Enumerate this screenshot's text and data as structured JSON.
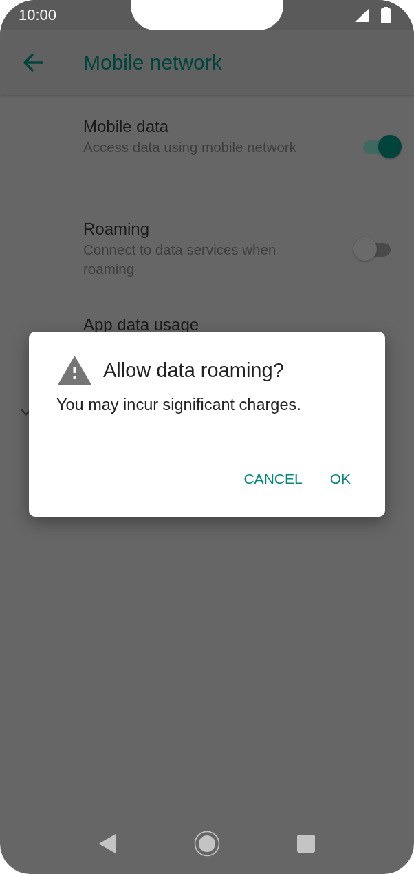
{
  "status_bar": {
    "time": "10:00"
  },
  "app_bar": {
    "title": "Mobile network"
  },
  "settings": [
    {
      "kind": "switch",
      "title": "Mobile data",
      "summary": "Access data using mobile network",
      "on": true
    },
    {
      "kind": "switch",
      "title": "Roaming",
      "summary": "Connect to data services when roaming",
      "on": false
    },
    {
      "kind": "link",
      "title": "App data usage"
    }
  ],
  "dialog": {
    "title": "Allow data roaming?",
    "message": "You may incur significant charges.",
    "buttons": [
      "CANCEL",
      "OK"
    ]
  }
}
